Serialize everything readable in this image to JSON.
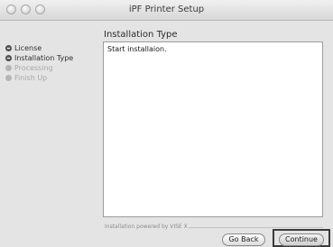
{
  "window": {
    "title": "iPF Printer Setup"
  },
  "main": {
    "section_title": "Installation Type",
    "content_text": "Start installaion.",
    "powered_by": "Installation powered by VISE X"
  },
  "sidebar": {
    "items": [
      {
        "label": "License",
        "state": "done"
      },
      {
        "label": "Installation Type",
        "state": "done"
      },
      {
        "label": "Processing",
        "state": "pending"
      },
      {
        "label": "Finish Up",
        "state": "pending"
      }
    ]
  },
  "buttons": {
    "back_label": "Go Back",
    "continue_label": "Continue"
  }
}
